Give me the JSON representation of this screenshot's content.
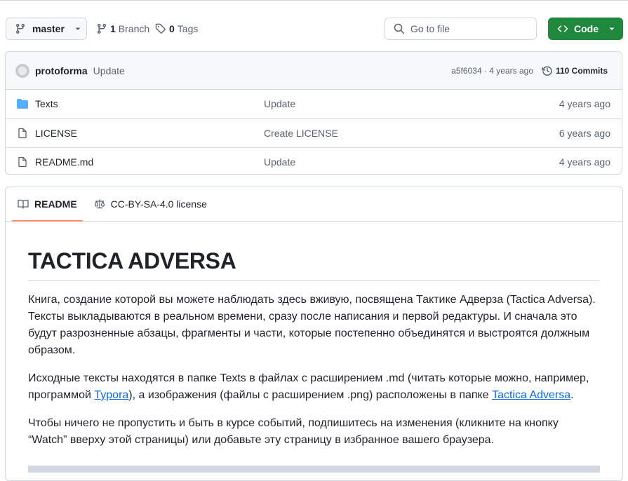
{
  "toolbar": {
    "branch_name": "master",
    "branches_count": "1",
    "branches_label": "Branch",
    "tags_count": "0",
    "tags_label": "Tags",
    "search_placeholder": "Go to file",
    "code_label": "Code",
    "code_color": "#1f883d"
  },
  "latest_commit": {
    "author": "protoforma",
    "message": "Update",
    "hash_time": "a5f6034 · 4 years ago",
    "commits_count": "110",
    "commits_label": "Commits"
  },
  "files": [
    {
      "name": "Texts",
      "type": "folder",
      "icon": "folder-icon",
      "message": "Update",
      "date": "4 years ago"
    },
    {
      "name": "LICENSE",
      "type": "file",
      "icon": "file-icon",
      "message": "Create LICENSE",
      "date": "6 years ago"
    },
    {
      "name": "README.md",
      "type": "file",
      "icon": "file-icon",
      "message": "Update",
      "date": "4 years ago"
    }
  ],
  "readme_tabs": {
    "readme": "README",
    "license": "CC-BY-SA-4.0 license",
    "active_underline_color": "#fd8c73"
  },
  "readme": {
    "title": "TACTICA ADVERSA",
    "p1": "Книга, создание которой вы можете наблюдать здесь вживую, посвящена Тактике Адверза (Tactica Adversa). Тексты выкладываются в реальном времени, сразу после написания и первой редактуры. И сначала это будут разрозненные абзацы, фрагменты и части, которые постепенно объединятся и выстроятся должным образом.",
    "p2_a": "Исходные тексты находятся в папке Texts в файлах с расширением .md (читать которые можно, например, программой ",
    "p2_link1": "Typora",
    "p2_b": "), а изображения (файлы с расширением .png) расположены в папке ",
    "p2_link2": "Tactica Adversa",
    "p2_c": ".",
    "p3": "Чтобы ничего не пропустить и быть в курсе событий, подпишитесь на изменения (кликните на кнопку “Watch” вверху этой страницы) или добавьте эту страницу в избранное вашего браузера.",
    "link_color": "#0969da"
  }
}
